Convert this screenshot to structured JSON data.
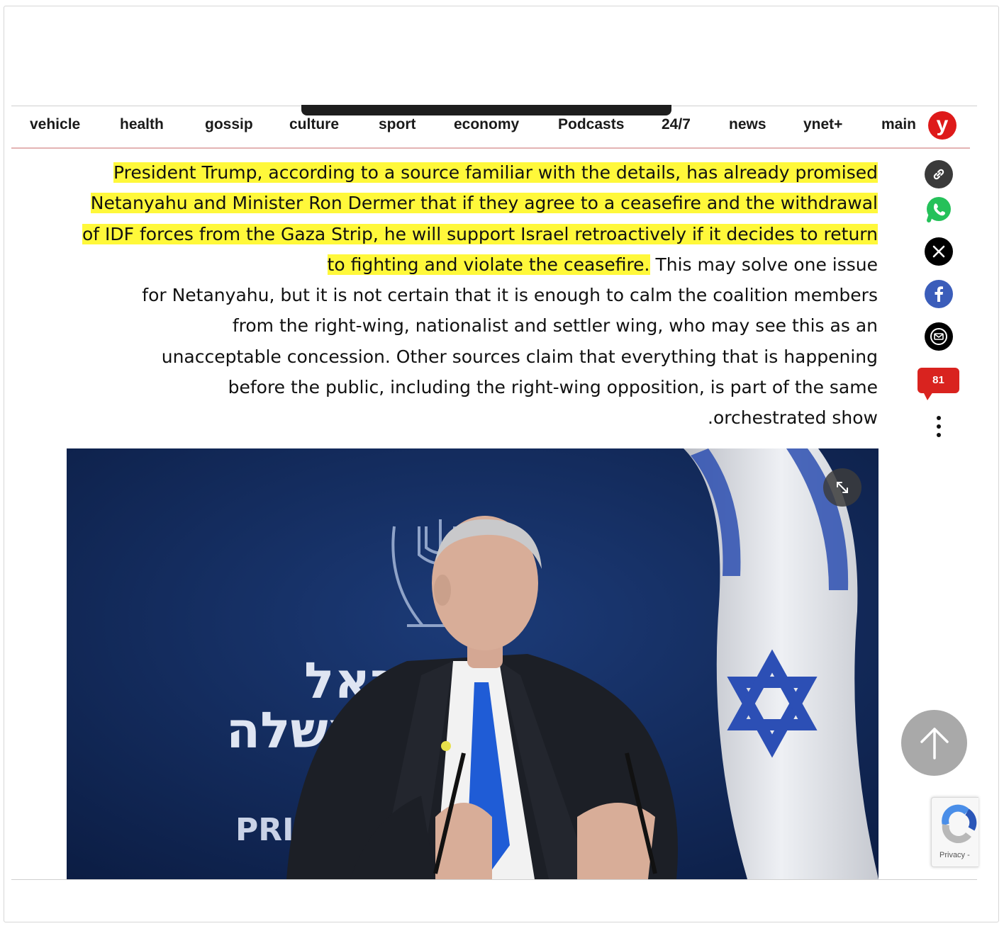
{
  "nav": {
    "items": [
      {
        "label": "vehicle"
      },
      {
        "label": "health"
      },
      {
        "label": "gossip"
      },
      {
        "label": "culture"
      },
      {
        "label": "sport"
      },
      {
        "label": "economy"
      },
      {
        "label": "Podcasts"
      },
      {
        "label": "24/7"
      },
      {
        "label": "news"
      },
      {
        "label": "ynet+"
      },
      {
        "label": "main"
      }
    ],
    "logo_letter": "y"
  },
  "article": {
    "highlighted": "President Trump, according to a source familiar with the details, has already promised Netanyahu and Minister Ron Dermer that if they agree to a ceasefire and the withdrawal of IDF forces from the Gaza Strip, he will support Israel retroactively if it decides to return to fighting and violate the ceasefire.",
    "line_5_tail": " This may solve one issue",
    "line_6": "for Netanyahu, but it is not certain that it is enough to calm the coalition members",
    "line_7": "from the right-wing, nationalist and settler wing, who may see this as an",
    "line_8": "unacceptable concession. Other sources claim that everything that is happening",
    "line_9": "before the public, including the right-wing opposition, is part of the same",
    "line_10": ".orchestrated show"
  },
  "share": {
    "icons": [
      "link-icon",
      "whatsapp-icon",
      "x-icon",
      "facebook-icon",
      "mail-icon"
    ],
    "comments_count": "81"
  },
  "photo": {
    "sign_line1": "ישראל",
    "sign_line2": "ממשלה",
    "sign_line3": "PRIM"
  },
  "recaptcha": {
    "label": "Privacy -"
  },
  "colors": {
    "highlight": "#fff83a",
    "logo": "#de1a1a",
    "comments": "#d9231f",
    "whatsapp": "#25c15a",
    "facebook": "#3b5dba"
  }
}
